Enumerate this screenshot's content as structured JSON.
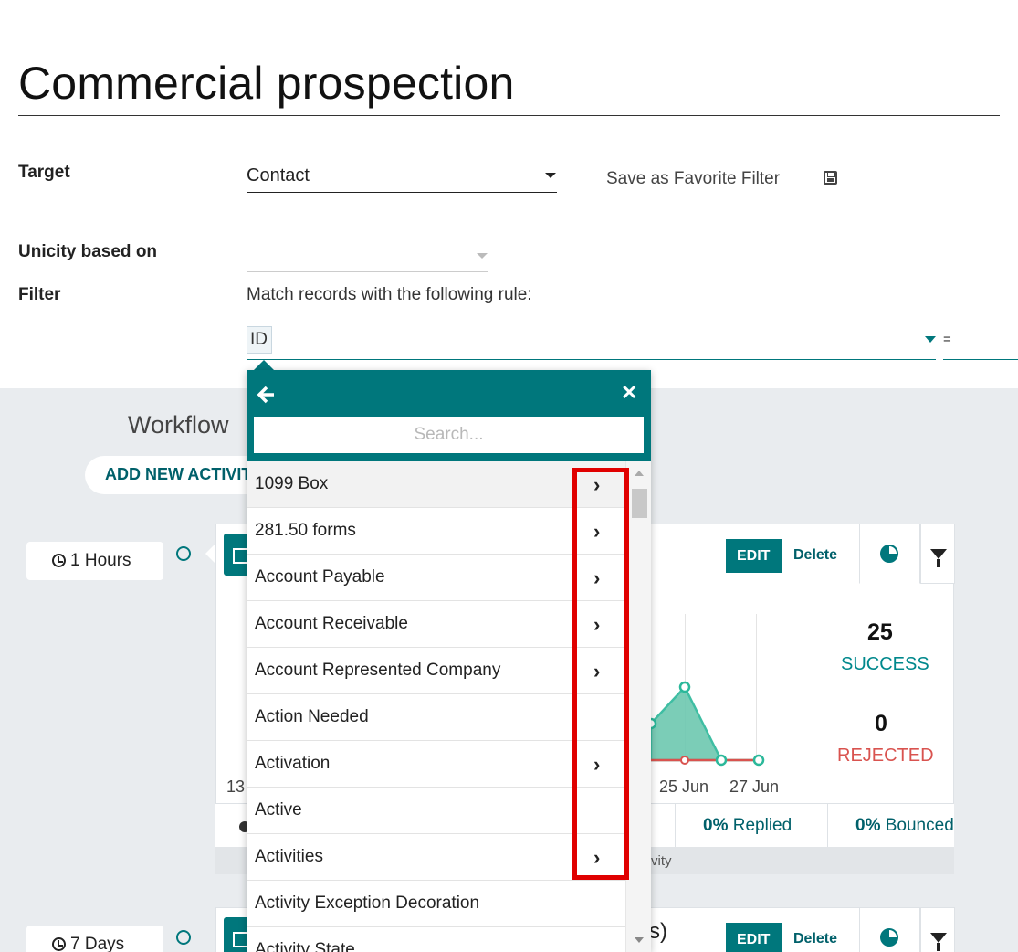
{
  "page_title": "Commercial prospection",
  "form": {
    "target_label": "Target",
    "target_value": "Contact",
    "save_favorite": "Save as Favorite Filter",
    "unicity_label": "Unicity based on",
    "unicity_value": "",
    "filter_label": "Filter",
    "filter_rule_text": "Match records with the following rule:",
    "filter_field": "ID",
    "filter_operator": "="
  },
  "workflow": {
    "title": "Workflow",
    "add_button": "ADD NEW ACTIVITY",
    "activities": [
      {
        "delay": "1 Hours",
        "edit": "EDIT",
        "delete": "Delete",
        "success_count": "25",
        "success_label": "SUCCESS",
        "rejected_count": "0",
        "rejected_label": "REJECTED",
        "x_labels": [
          "13",
          "25 Jun",
          "27 Jun"
        ],
        "stats": [
          {
            "pct": "0%",
            "label": "Replied"
          },
          {
            "pct": "0%",
            "label": "Bounced"
          }
        ],
        "footer_text": "vity",
        "chart_data": {
          "type": "area",
          "series": [
            {
              "values": [
                0,
                0,
                0,
                25,
                0,
                0
              ]
            },
            {
              "values": [
                0,
                0,
                0,
                0,
                0,
                0
              ]
            }
          ]
        }
      },
      {
        "delay": "7 Days",
        "title_fragment": "s)",
        "edit": "EDIT",
        "delete": "Delete"
      }
    ]
  },
  "dropdown": {
    "search_placeholder": "Search...",
    "items": [
      {
        "label": "1099 Box",
        "has_children": true
      },
      {
        "label": "281.50 forms",
        "has_children": true
      },
      {
        "label": "Account Payable",
        "has_children": true
      },
      {
        "label": "Account Receivable",
        "has_children": true
      },
      {
        "label": "Account Represented Company",
        "has_children": true
      },
      {
        "label": "Action Needed",
        "has_children": false
      },
      {
        "label": "Activation",
        "has_children": true
      },
      {
        "label": "Active",
        "has_children": false
      },
      {
        "label": "Activities",
        "has_children": true
      },
      {
        "label": "Activity Exception Decoration",
        "has_children": false
      },
      {
        "label": "Activity State",
        "has_children": false
      }
    ],
    "chevron_glyph": "›"
  },
  "colors": {
    "primary": "#00777c",
    "success": "#00888c",
    "danger": "#d9534f",
    "highlight": "#e00000",
    "background_grey": "#e9ecef"
  }
}
